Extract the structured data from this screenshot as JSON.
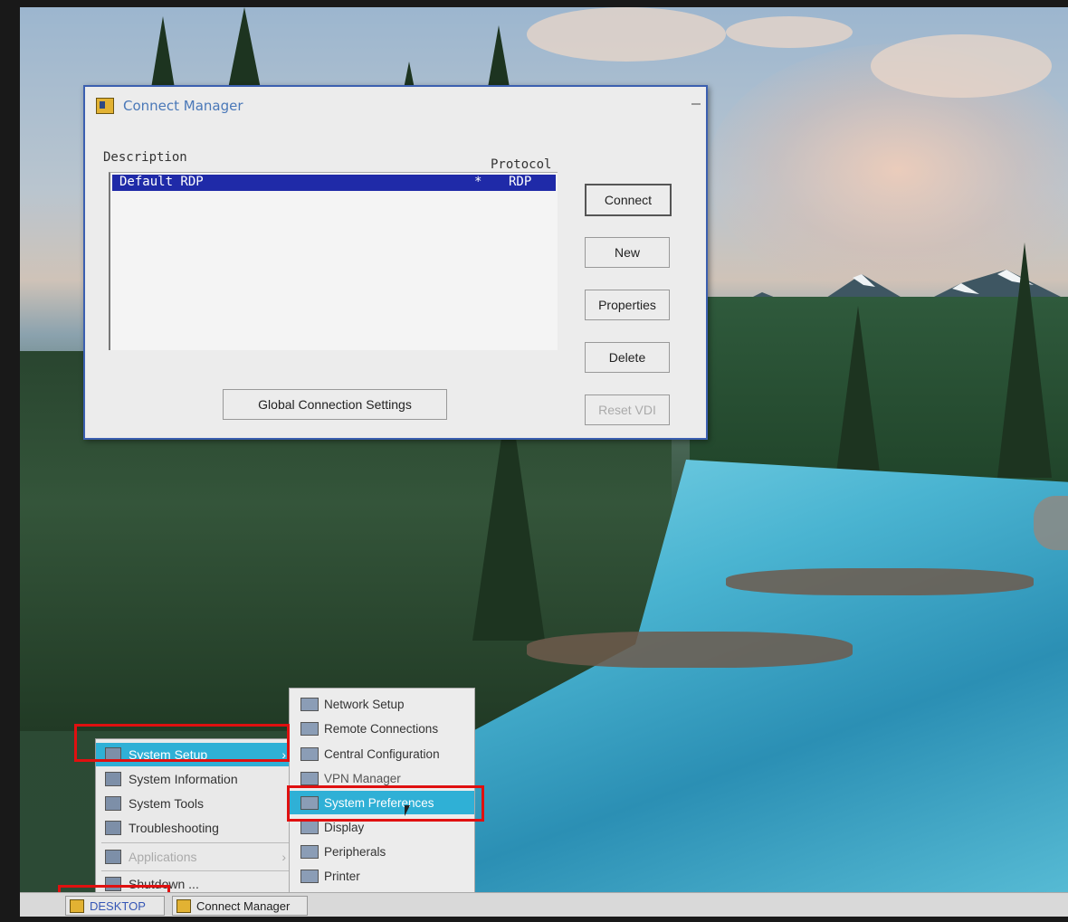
{
  "connect_manager": {
    "title": "Connect Manager",
    "columns": {
      "description": "Description",
      "protocol": "Protocol"
    },
    "rows": [
      {
        "description": "Default RDP",
        "marker": "*",
        "protocol": "RDP",
        "selected": true
      }
    ],
    "buttons": {
      "connect": "Connect",
      "new": "New",
      "properties": "Properties",
      "delete": "Delete",
      "reset_vdi": "Reset VDI",
      "global_settings": "Global Connection Settings"
    }
  },
  "start_menu": {
    "items": [
      {
        "label": "System Setup",
        "active": true,
        "has_submenu": true
      },
      {
        "label": "System Information"
      },
      {
        "label": "System Tools"
      },
      {
        "label": "Troubleshooting"
      },
      {
        "label": "Applications",
        "disabled": true,
        "has_submenu": true
      },
      {
        "label": "Shutdown ..."
      }
    ],
    "arrow": "›"
  },
  "system_setup_submenu": {
    "items": [
      {
        "label": "Network Setup"
      },
      {
        "label": "Remote Connections"
      },
      {
        "label": "Central Configuration"
      },
      {
        "label": "VPN Manager"
      },
      {
        "label": "System Preferences",
        "active": true
      },
      {
        "label": "Display"
      },
      {
        "label": "Peripherals"
      },
      {
        "label": "Printer"
      }
    ]
  },
  "taskbar": {
    "desktop": "DESKTOP",
    "task": "Connect Manager"
  },
  "colors": {
    "highlight": "#2fb0d6",
    "selection": "#1f2aa8",
    "callout_box": "#e01010"
  }
}
